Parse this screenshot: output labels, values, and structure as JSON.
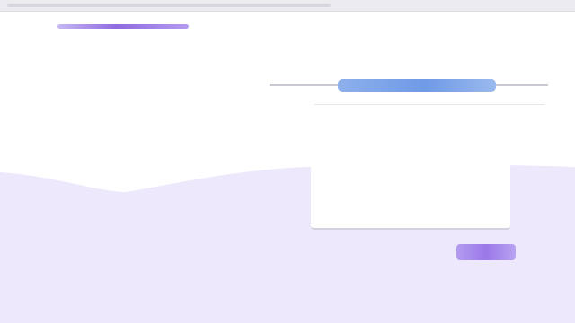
{
  "browser": {
    "tab_strip": ""
  },
  "brand": {
    "logo_text": "",
    "accent_color": "#9a78e8"
  },
  "signin": {
    "heading": "",
    "google_button_label": "",
    "email_label": "",
    "email_value": "",
    "email_placeholder": "",
    "next_button_label": ""
  },
  "theme": {
    "background_top": "#ffffff",
    "background_bottom": "#ede8fc",
    "google_button_color": "#7aa2e8"
  }
}
